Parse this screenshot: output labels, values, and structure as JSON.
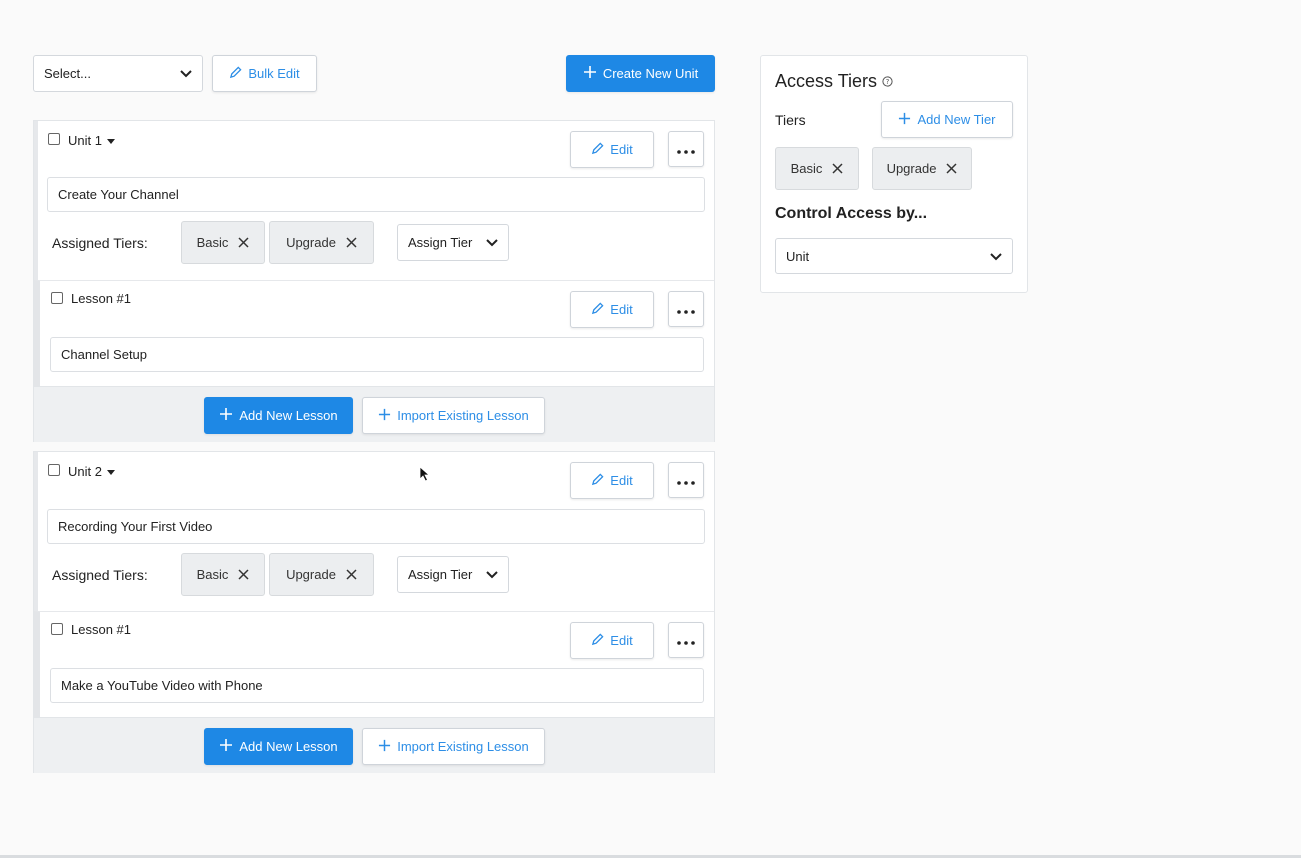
{
  "toolbar": {
    "select_value": "Select...",
    "bulk_edit_label": "Bulk Edit",
    "create_unit_label": "Create New Unit"
  },
  "units": [
    {
      "name": "Unit 1",
      "title": "Create Your Channel",
      "edit_label": "Edit",
      "assigned_tiers_label": "Assigned Tiers:",
      "tiers": [
        "Basic",
        "Upgrade"
      ],
      "assign_tier_label": "Assign Tier",
      "lesson": {
        "name": "Lesson #1",
        "title": "Channel Setup",
        "edit_label": "Edit"
      },
      "add_lesson_label": "Add New Lesson",
      "import_lesson_label": "Import Existing Lesson"
    },
    {
      "name": "Unit 2",
      "title": "Recording Your First Video",
      "edit_label": "Edit",
      "assigned_tiers_label": "Assigned Tiers:",
      "tiers": [
        "Basic",
        "Upgrade"
      ],
      "assign_tier_label": "Assign Tier",
      "lesson": {
        "name": "Lesson #1",
        "title": "Make a YouTube Video with Phone",
        "edit_label": "Edit"
      },
      "add_lesson_label": "Add New Lesson",
      "import_lesson_label": "Import Existing Lesson"
    }
  ],
  "access_panel": {
    "title": "Access Tiers",
    "tiers_label": "Tiers",
    "add_tier_label": "Add New Tier",
    "tiers": [
      "Basic",
      "Upgrade"
    ],
    "control_heading": "Control Access by...",
    "control_value": "Unit"
  },
  "colors": {
    "accent": "#1e88e5",
    "accent_text": "#2d8ee6",
    "tag_bg": "#eceef0",
    "footer_bg": "#eef0f2"
  },
  "icons": [
    "chevron-down-icon",
    "pencil-icon",
    "plus-icon",
    "more-dots-icon",
    "close-icon",
    "help-icon",
    "caret-down-icon",
    "mouse-cursor-icon"
  ]
}
